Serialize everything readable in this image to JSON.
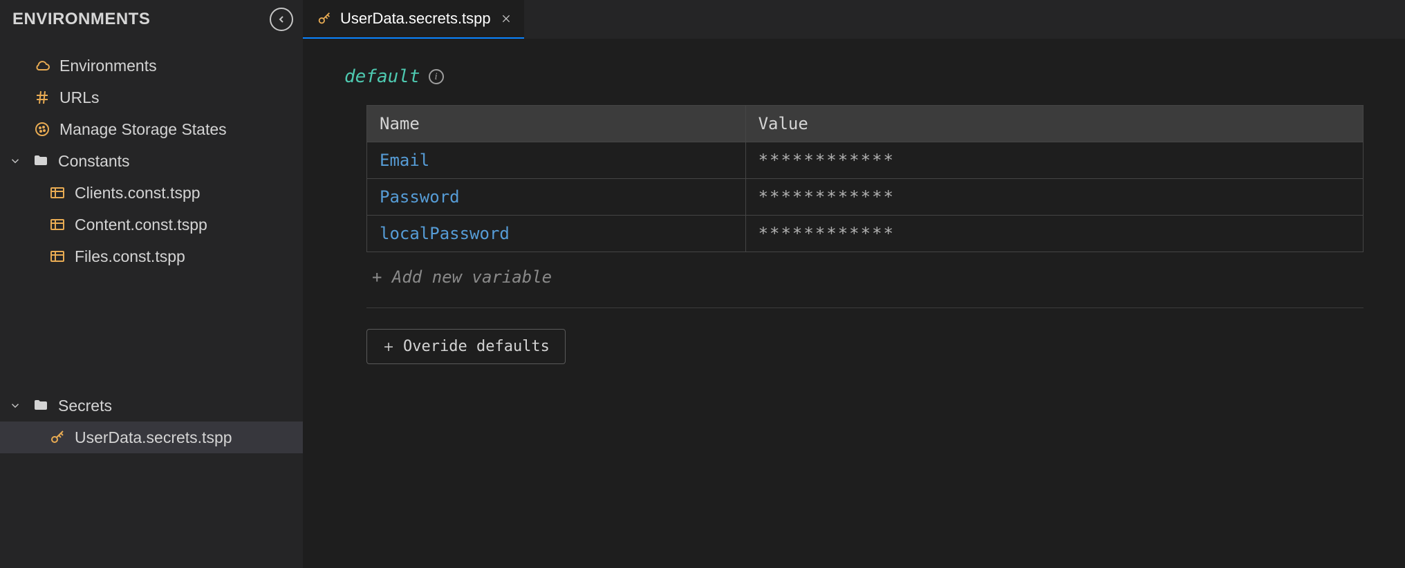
{
  "sidebar": {
    "title": "ENVIRONMENTS",
    "items": [
      {
        "label": "Environments",
        "icon": "cloud"
      },
      {
        "label": "URLs",
        "icon": "hash"
      },
      {
        "label": "Manage Storage States",
        "icon": "cookie"
      }
    ],
    "groups": [
      {
        "label": "Constants",
        "expanded": true,
        "children": [
          {
            "label": "Clients.const.tspp",
            "icon": "table"
          },
          {
            "label": "Content.const.tspp",
            "icon": "table"
          },
          {
            "label": "Files.const.tspp",
            "icon": "table"
          }
        ]
      },
      {
        "label": "Secrets",
        "expanded": true,
        "children": [
          {
            "label": "UserData.secrets.tspp",
            "icon": "key",
            "selected": true
          }
        ]
      }
    ]
  },
  "tabs": [
    {
      "label": "UserData.secrets.tspp",
      "icon": "key",
      "active": true
    }
  ],
  "editor": {
    "section_label": "default",
    "columns": {
      "name": "Name",
      "value": "Value"
    },
    "variables": [
      {
        "name": "Email",
        "value": "************"
      },
      {
        "name": "Password",
        "value": "************"
      },
      {
        "name": "localPassword",
        "value": "************"
      }
    ],
    "add_label": "+ Add new variable",
    "override_label": "Overide defaults"
  },
  "colors": {
    "accent_teal": "#4ec9b0",
    "accent_blue": "#569cd6",
    "accent_orange": "#e8ab53",
    "tab_active_underline": "#0a84ff"
  }
}
